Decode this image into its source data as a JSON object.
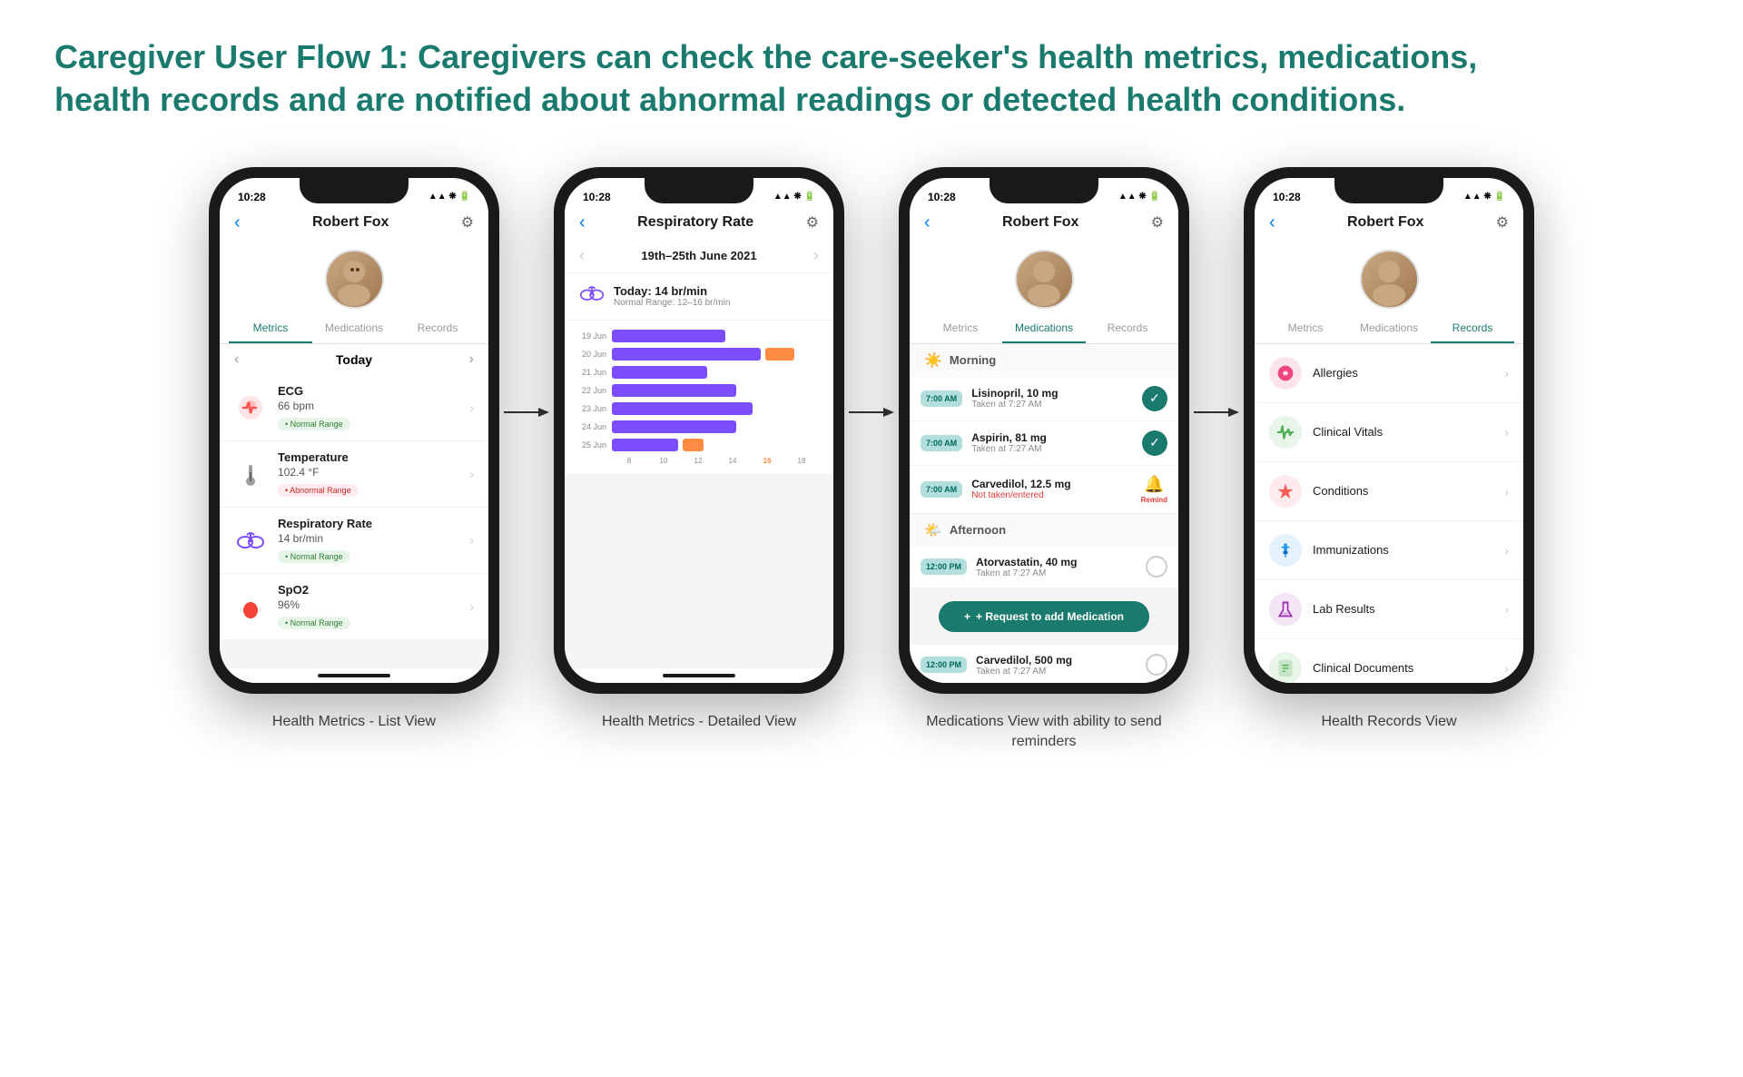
{
  "page": {
    "title_line1": "Caregiver User Flow 1: Caregivers can check the care-seeker's health metrics, medications,",
    "title_line2": "health records and are notified about abnormal readings or detected health conditions."
  },
  "phone1": {
    "status_time": "10:28",
    "nav_title": "Robert Fox",
    "tabs": [
      "Metrics",
      "Medications",
      "Records"
    ],
    "active_tab": "Metrics",
    "date_label": "Today",
    "metrics": [
      {
        "name": "ECG",
        "value": "66 bpm",
        "badge": "Normal Range",
        "badge_type": "normal",
        "icon": "heart"
      },
      {
        "name": "Temperature",
        "value": "102.4 °F",
        "badge": "Abnormal Range",
        "badge_type": "abnormal",
        "icon": "thermometer"
      },
      {
        "name": "Respiratory Rate",
        "value": "14 br/min",
        "badge": "Normal Range",
        "badge_type": "normal",
        "icon": "lungs"
      },
      {
        "name": "SpO2",
        "value": "96%",
        "badge": "Normal Range",
        "badge_type": "normal",
        "icon": "drop"
      }
    ],
    "caption": "Health Metrics - List View"
  },
  "phone2": {
    "status_time": "10:28",
    "nav_title": "Respiratory Rate",
    "date_range": "19th–25th June 2021",
    "today_value": "Today: 14 br/min",
    "today_sub": "Normal Range: 12–16 br/min",
    "chart_rows": [
      {
        "label": "19 Jun",
        "purple": 60,
        "orange": 0
      },
      {
        "label": "20 Jun",
        "purple": 80,
        "orange": 95
      },
      {
        "label": "21 Jun",
        "purple": 50,
        "orange": 0
      },
      {
        "label": "22 Jun",
        "purple": 65,
        "orange": 0
      },
      {
        "label": "23 Jun",
        "purple": 75,
        "orange": 0
      },
      {
        "label": "24 Jun",
        "purple": 65,
        "orange": 0
      },
      {
        "label": "25 Jun",
        "purple": 35,
        "orange": 50
      }
    ],
    "x_labels": [
      "8",
      "10",
      "12",
      "14",
      "16",
      "18"
    ],
    "caption": "Health Metrics - Detailed View"
  },
  "phone3": {
    "status_time": "10:28",
    "nav_title": "Robert Fox",
    "tabs": [
      "Metrics",
      "Medications",
      "Records"
    ],
    "active_tab": "Medications",
    "morning_label": "Morning",
    "afternoon_label": "Afternoon",
    "morning_meds": [
      {
        "time": "7:00 AM",
        "name": "Lisinopril, 10 mg",
        "status": "Taken at 7:27 AM",
        "taken": true
      },
      {
        "time": "7:00 AM",
        "name": "Aspirin, 81 mg",
        "status": "Taken at 7:27 AM",
        "taken": true
      },
      {
        "time": "7:00 AM",
        "name": "Carvedilol, 12.5 mg",
        "status": "Not taken/entered",
        "taken": false
      }
    ],
    "afternoon_meds": [
      {
        "time": "12:00 PM",
        "name": "Atorvastatin, 40 mg",
        "status": "Taken at 7:27 AM",
        "taken": true
      },
      {
        "time": "12:00 PM",
        "name": "Carvedilol, 500 mg",
        "status": "Taken at 7:27 AM",
        "taken": true
      }
    ],
    "add_btn_label": "+ Request to add Medication",
    "caption": "Medications View with ability to send reminders"
  },
  "phone4": {
    "status_time": "10:28",
    "nav_title": "Robert Fox",
    "tabs": [
      "Metrics",
      "Medications",
      "Records"
    ],
    "active_tab": "Records",
    "records": [
      {
        "name": "Allergies",
        "icon": "🌺",
        "color": "#e91e63"
      },
      {
        "name": "Clinical Vitals",
        "icon": "⚡",
        "color": "#4caf50"
      },
      {
        "name": "Conditions",
        "icon": "✳️",
        "color": "#f44336"
      },
      {
        "name": "Immunizations",
        "icon": "💉",
        "color": "#2196f3"
      },
      {
        "name": "Lab Results",
        "icon": "🧪",
        "color": "#9c27b0"
      },
      {
        "name": "Clinical Documents",
        "icon": "📋",
        "color": "#4caf50"
      }
    ],
    "caption": "Health Records View"
  }
}
